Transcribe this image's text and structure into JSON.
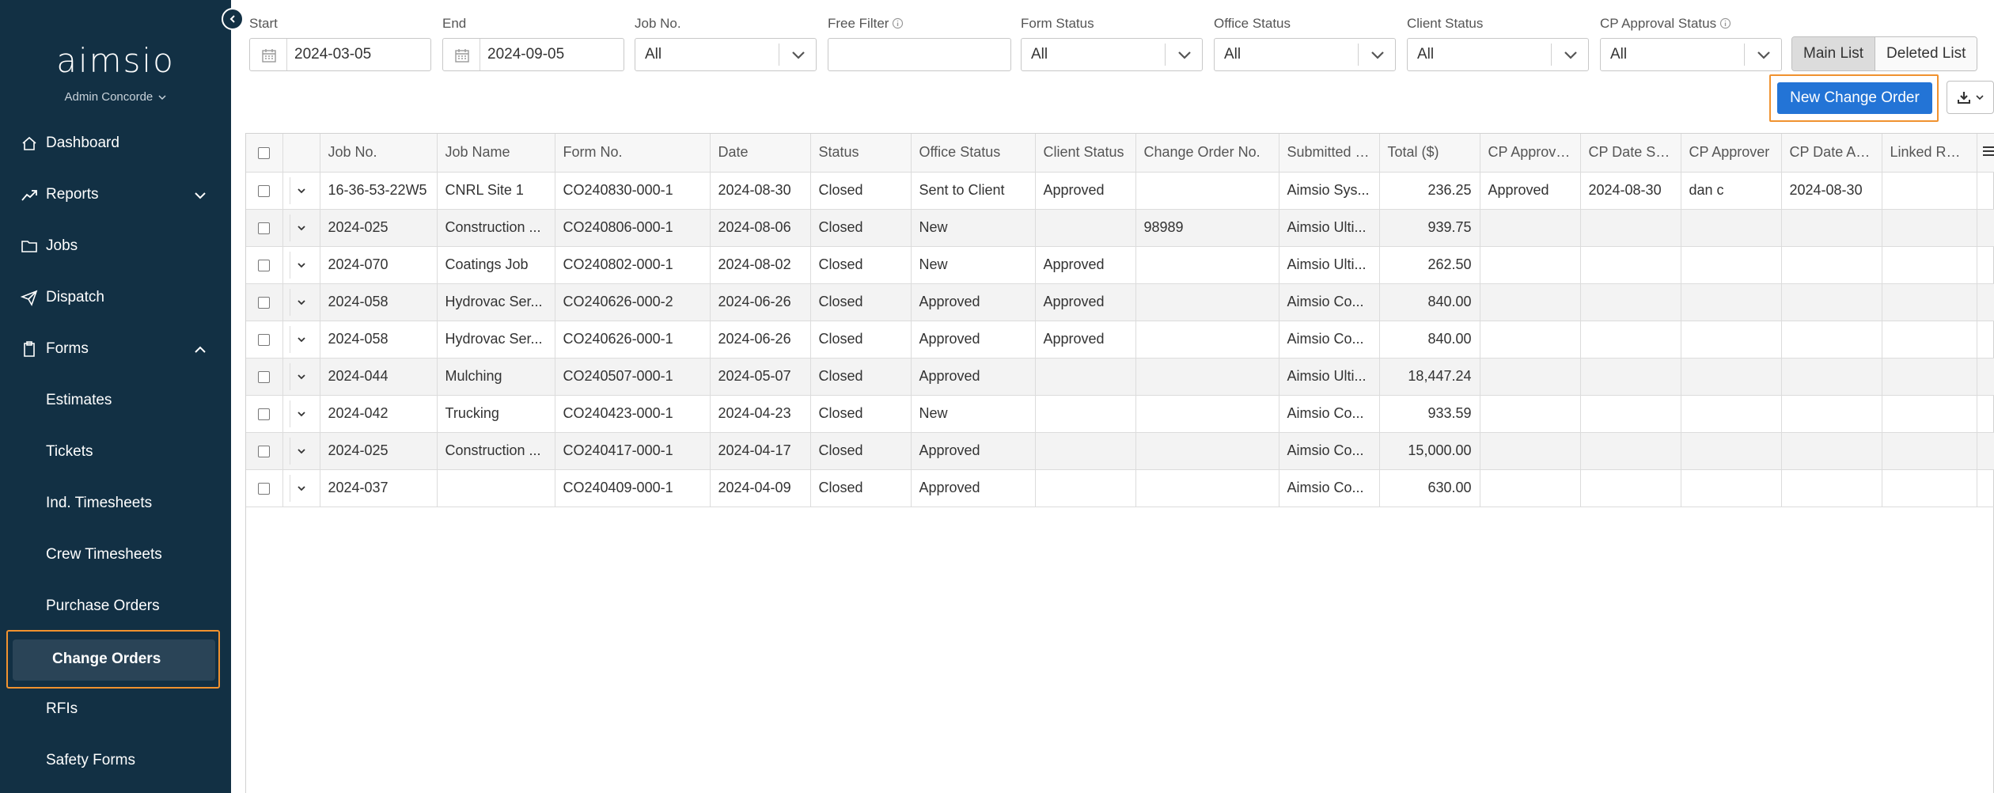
{
  "sidebar": {
    "logo": "aimsio",
    "user": "Admin Concorde",
    "nav": [
      {
        "label": "Dashboard",
        "icon": "home-icon"
      },
      {
        "label": "Reports",
        "icon": "chart-line-icon"
      },
      {
        "label": "Jobs",
        "icon": "folder-icon"
      },
      {
        "label": "Dispatch",
        "icon": "paper-plane-icon"
      },
      {
        "label": "Forms",
        "icon": "clipboard-icon"
      }
    ],
    "forms_sub": [
      {
        "label": "Estimates"
      },
      {
        "label": "Tickets"
      },
      {
        "label": "Ind. Timesheets"
      },
      {
        "label": "Crew Timesheets"
      },
      {
        "label": "Purchase Orders"
      },
      {
        "label": "Change Orders"
      },
      {
        "label": "RFIs"
      },
      {
        "label": "Safety Forms"
      }
    ],
    "active_item": "Change Orders"
  },
  "filters": {
    "start": {
      "label": "Start",
      "value": "2024-03-05"
    },
    "end": {
      "label": "End",
      "value": "2024-09-05"
    },
    "job_no": {
      "label": "Job No.",
      "value": "All"
    },
    "free_filter": {
      "label": "Free Filter",
      "value": ""
    },
    "form_status": {
      "label": "Form Status",
      "value": "All"
    },
    "office_status": {
      "label": "Office Status",
      "value": "All"
    },
    "client_status": {
      "label": "Client Status",
      "value": "All"
    },
    "cp_approval_status": {
      "label": "CP Approval Status",
      "value": "All"
    }
  },
  "toolbar": {
    "main_list": "Main List",
    "deleted_list": "Deleted List",
    "new_change_order": "New Change Order",
    "accent_color": "#2374d6",
    "highlight_color": "#f0922f"
  },
  "table": {
    "columns": [
      "Job No.",
      "Job Name",
      "Form No.",
      "Date",
      "Status",
      "Office Status",
      "Client Status",
      "Change Order No.",
      "Submitted By",
      "Total ($)",
      "CP Approva...",
      "CP Date Sent",
      "CP Approver",
      "CP Date Ap...",
      "Linked RFI ..."
    ],
    "rows": [
      [
        "16-36-53-22W5",
        "CNRL Site 1",
        "CO240830-000-1",
        "2024-08-30",
        "Closed",
        "Sent to Client",
        "Approved",
        "",
        "Aimsio Sys...",
        "236.25",
        "Approved",
        "2024-08-30",
        "dan c",
        "2024-08-30",
        ""
      ],
      [
        "2024-025",
        "Construction ...",
        "CO240806-000-1",
        "2024-08-06",
        "Closed",
        "New",
        "",
        "98989",
        "Aimsio Ulti...",
        "939.75",
        "",
        "",
        "",
        "",
        ""
      ],
      [
        "2024-070",
        "Coatings Job",
        "CO240802-000-1",
        "2024-08-02",
        "Closed",
        "New",
        "Approved",
        "",
        "Aimsio Ulti...",
        "262.50",
        "",
        "",
        "",
        "",
        ""
      ],
      [
        "2024-058",
        "Hydrovac Ser...",
        "CO240626-000-2",
        "2024-06-26",
        "Closed",
        "Approved",
        "Approved",
        "",
        "Aimsio Co...",
        "840.00",
        "",
        "",
        "",
        "",
        ""
      ],
      [
        "2024-058",
        "Hydrovac Ser...",
        "CO240626-000-1",
        "2024-06-26",
        "Closed",
        "Approved",
        "Approved",
        "",
        "Aimsio Co...",
        "840.00",
        "",
        "",
        "",
        "",
        ""
      ],
      [
        "2024-044",
        "Mulching",
        "CO240507-000-1",
        "2024-05-07",
        "Closed",
        "Approved",
        "",
        "",
        "Aimsio Ulti...",
        "18,447.24",
        "",
        "",
        "",
        "",
        ""
      ],
      [
        "2024-042",
        "Trucking",
        "CO240423-000-1",
        "2024-04-23",
        "Closed",
        "New",
        "",
        "",
        "Aimsio Co...",
        "933.59",
        "",
        "",
        "",
        "",
        ""
      ],
      [
        "2024-025",
        "Construction ...",
        "CO240417-000-1",
        "2024-04-17",
        "Closed",
        "Approved",
        "",
        "",
        "Aimsio Co...",
        "15,000.00",
        "",
        "",
        "",
        "",
        ""
      ],
      [
        "2024-037",
        "",
        "CO240409-000-1",
        "2024-04-09",
        "Closed",
        "Approved",
        "",
        "",
        "Aimsio Co...",
        "630.00",
        "",
        "",
        "",
        "",
        ""
      ]
    ]
  }
}
